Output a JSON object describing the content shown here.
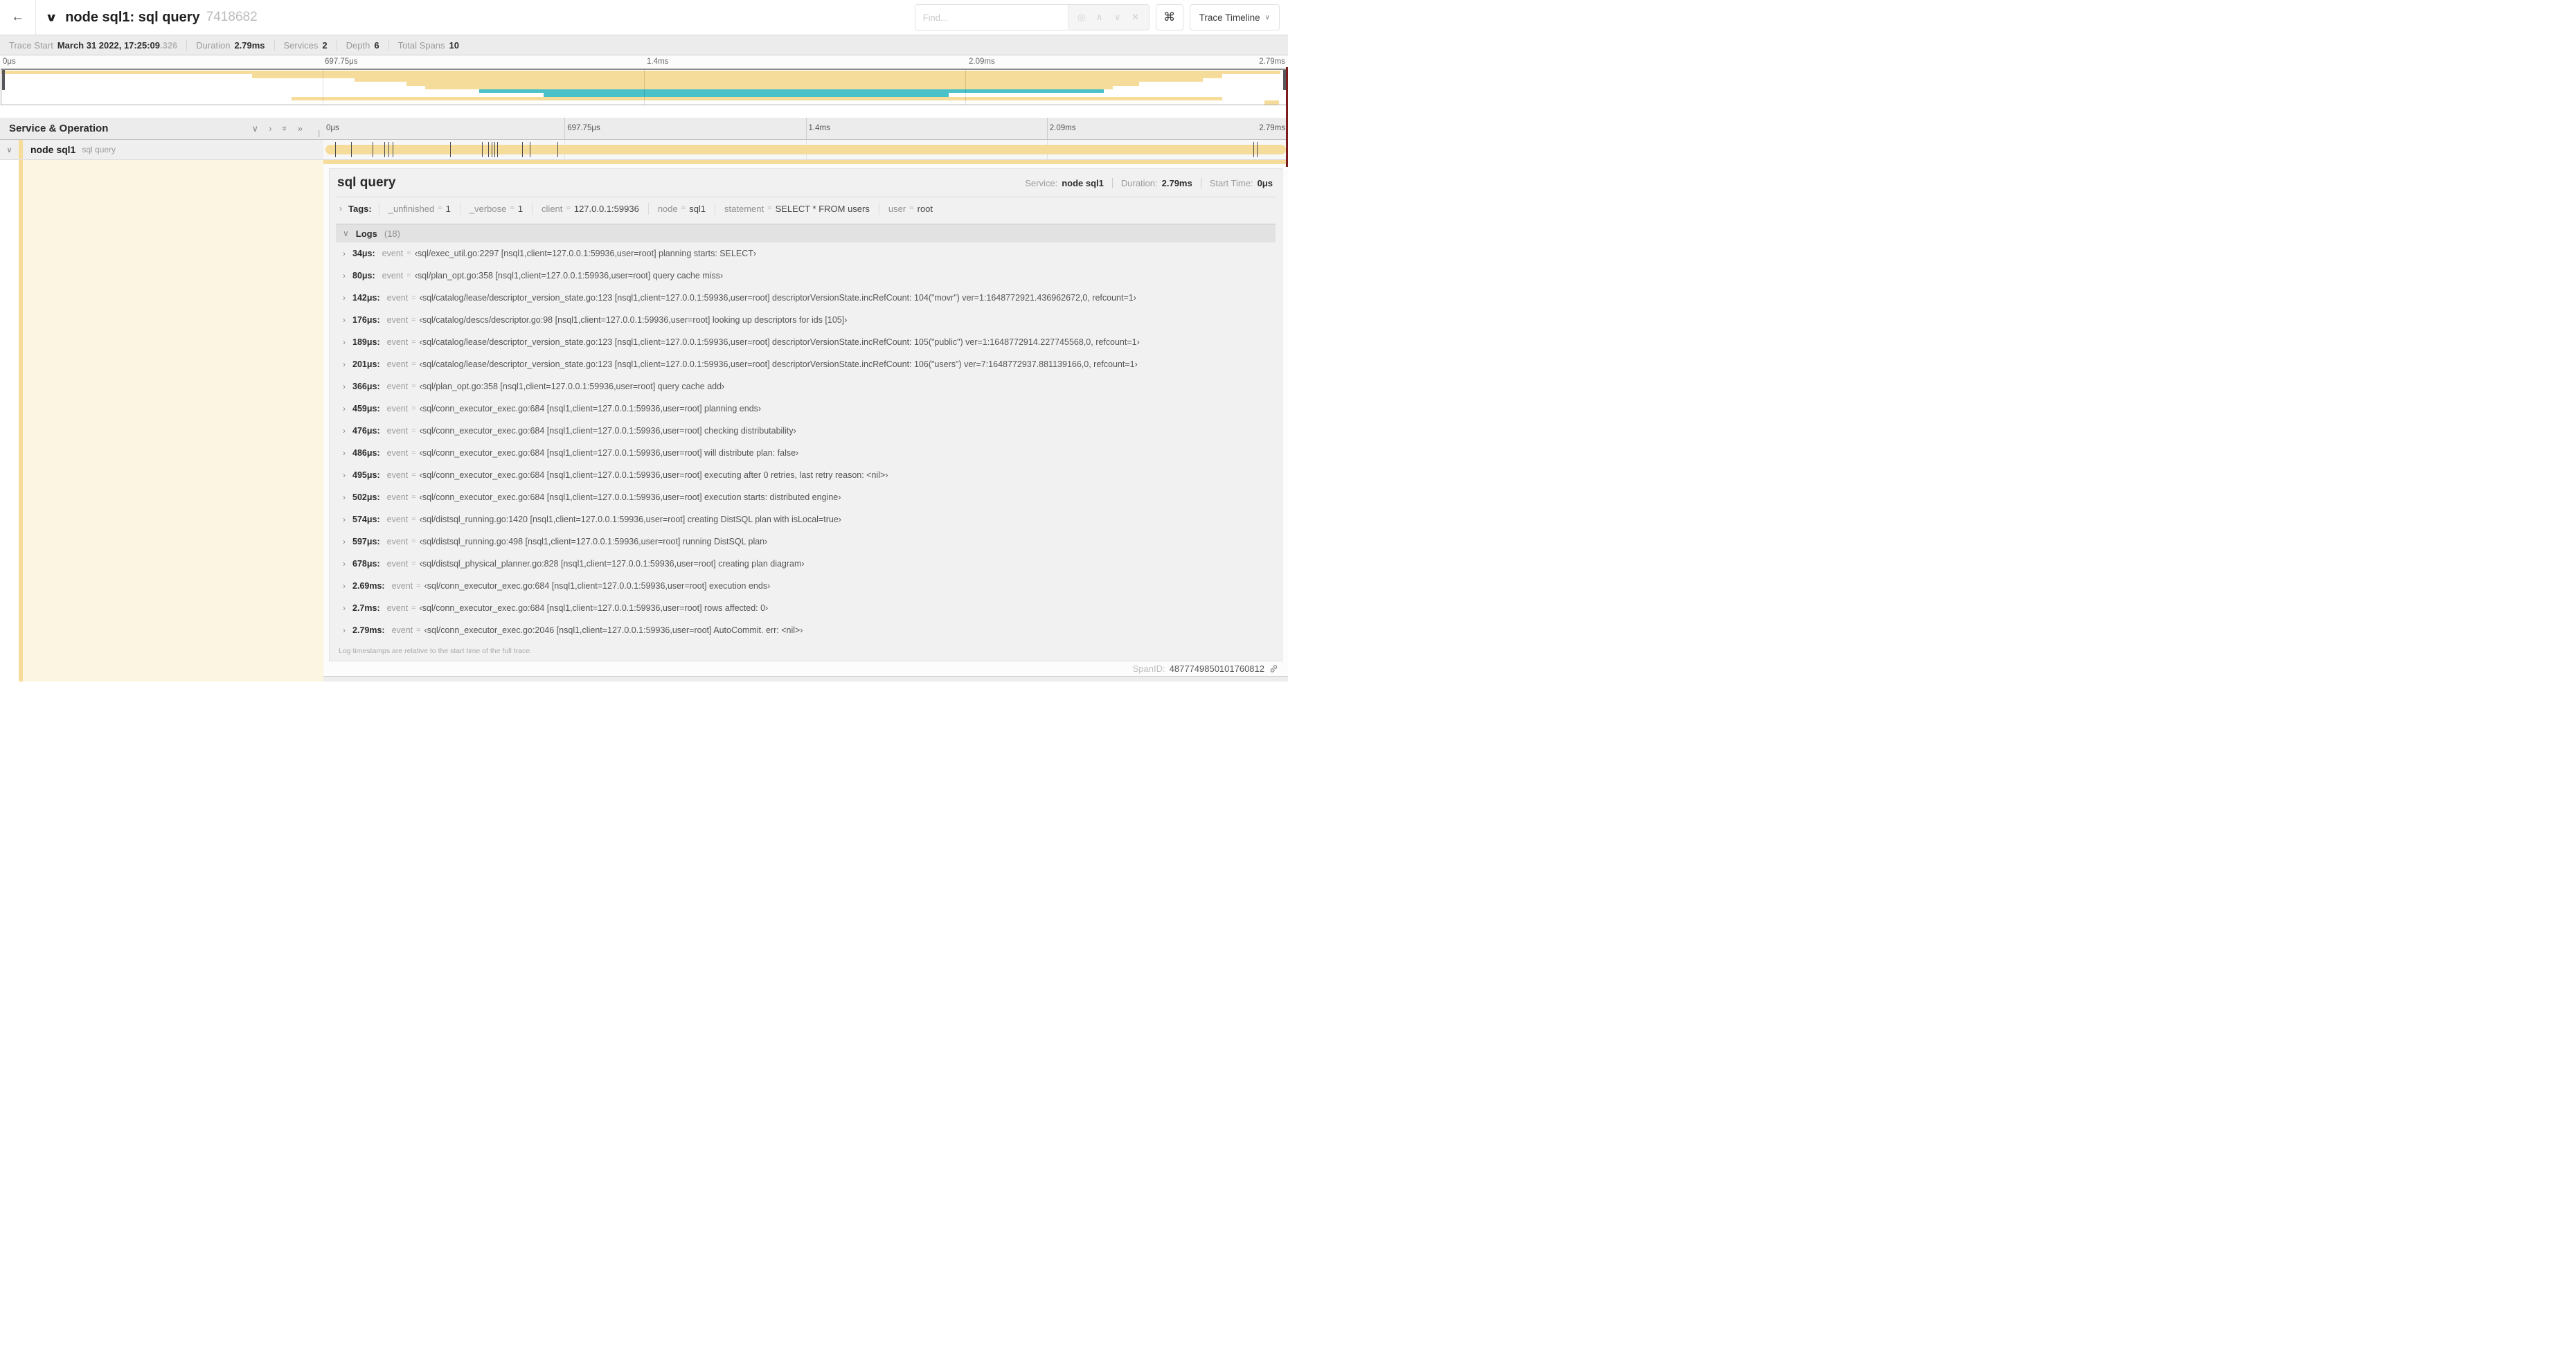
{
  "header": {
    "title": "node sql1: sql query",
    "trace_id": "7418682",
    "find_placeholder": "Find...",
    "view_selector": "Trace Timeline"
  },
  "icons": {
    "back": "←",
    "chevron_down": "∨",
    "chevron_right": "›",
    "double_chevron": "»",
    "locate": "◎",
    "prev": "∧",
    "next": "∨",
    "clear": "✕",
    "command": "⌘",
    "resize_grip": "∥"
  },
  "colors": {
    "span_bar": "#F5DC9B",
    "teal_bar": "#49C1C8",
    "detail_sidebar_bg": "#FCF5E2",
    "accent_edge": "#7B1D1D"
  },
  "trace_meta": {
    "items": [
      {
        "label": "Trace Start",
        "value": "March 31 2022, 17:25:09",
        "suffix": ".326"
      },
      {
        "label": "Duration",
        "value": "2.79ms"
      },
      {
        "label": "Services",
        "value": "2"
      },
      {
        "label": "Depth",
        "value": "6"
      },
      {
        "label": "Total Spans",
        "value": "10"
      }
    ]
  },
  "timeline": {
    "column_header": "Service & Operation",
    "ticks": [
      "0μs",
      "697.75μs",
      "1.4ms",
      "2.09ms",
      "2.79ms"
    ],
    "tick_positions": [
      0,
      25,
      50,
      75,
      100
    ]
  },
  "minimap": {
    "bars": [
      {
        "start": 0,
        "end": 99.5,
        "color": "#F5DC9B"
      },
      {
        "start": 19.5,
        "end": 95,
        "color": "#F5DC9B"
      },
      {
        "start": 27.5,
        "end": 93.5,
        "color": "#F5DC9B"
      },
      {
        "start": 31.5,
        "end": 88.5,
        "color": "#F5DC9B"
      },
      {
        "start": 33,
        "end": 86.5,
        "color": "#F5DC9B"
      },
      {
        "start": 37.2,
        "end": 85.8,
        "color": "#49C1C8"
      },
      {
        "start": 42.2,
        "end": 73.7,
        "color": "#49C1C8"
      },
      {
        "start": 22.6,
        "end": 95,
        "color": "#F5DC9B"
      },
      {
        "start": 98.3,
        "end": 99.4,
        "color": "#F5DC9B"
      }
    ]
  },
  "span_row": {
    "service": "node sql1",
    "operation": "sql query",
    "log_marker_positions": [
      1.22,
      2.87,
      5.09,
      6.31,
      6.77,
      7.2,
      13.12,
      16.45,
      17.06,
      17.42,
      17.74,
      18.0,
      20.57,
      21.4,
      24.3,
      96.42,
      96.77
    ]
  },
  "detail": {
    "title": "sql query",
    "info": [
      {
        "label": "Service:",
        "value": "node sql1"
      },
      {
        "label": "Duration:",
        "value": "2.79ms"
      },
      {
        "label": "Start Time:",
        "value": "0μs"
      }
    ],
    "tags": {
      "label": "Tags:",
      "eq": "=",
      "items": [
        {
          "key": "_unfinished",
          "value": "1"
        },
        {
          "key": "_verbose",
          "value": "1"
        },
        {
          "key": "client",
          "value": "127.0.0.1:59936"
        },
        {
          "key": "node",
          "value": "sql1"
        },
        {
          "key": "statement",
          "value": "SELECT * FROM users"
        },
        {
          "key": "user",
          "value": "root"
        }
      ]
    },
    "logs": {
      "label": "Logs",
      "count": "(18)",
      "field_label": "event",
      "eq": "=",
      "entries": [
        {
          "time": "34μs:",
          "value": "‹sql/exec_util.go:2297 [nsql1,client=127.0.0.1:59936,user=root] planning starts: SELECT›"
        },
        {
          "time": "80μs:",
          "value": "‹sql/plan_opt.go:358 [nsql1,client=127.0.0.1:59936,user=root] query cache miss›"
        },
        {
          "time": "142μs:",
          "value": "‹sql/catalog/lease/descriptor_version_state.go:123 [nsql1,client=127.0.0.1:59936,user=root] descriptorVersionState.incRefCount: 104(\"movr\") ver=1:1648772921.436962672,0, refcount=1›"
        },
        {
          "time": "176μs:",
          "value": "‹sql/catalog/descs/descriptor.go:98 [nsql1,client=127.0.0.1:59936,user=root] looking up descriptors for ids [105]›"
        },
        {
          "time": "189μs:",
          "value": "‹sql/catalog/lease/descriptor_version_state.go:123 [nsql1,client=127.0.0.1:59936,user=root] descriptorVersionState.incRefCount: 105(\"public\") ver=1:1648772914.227745568,0, refcount=1›"
        },
        {
          "time": "201μs:",
          "value": "‹sql/catalog/lease/descriptor_version_state.go:123 [nsql1,client=127.0.0.1:59936,user=root] descriptorVersionState.incRefCount: 106(\"users\") ver=7:1648772937.881139166,0, refcount=1›"
        },
        {
          "time": "366μs:",
          "value": "‹sql/plan_opt.go:358 [nsql1,client=127.0.0.1:59936,user=root] query cache add›"
        },
        {
          "time": "459μs:",
          "value": "‹sql/conn_executor_exec.go:684 [nsql1,client=127.0.0.1:59936,user=root] planning ends›"
        },
        {
          "time": "476μs:",
          "value": "‹sql/conn_executor_exec.go:684 [nsql1,client=127.0.0.1:59936,user=root] checking distributability›"
        },
        {
          "time": "486μs:",
          "value": "‹sql/conn_executor_exec.go:684 [nsql1,client=127.0.0.1:59936,user=root] will distribute plan: false›"
        },
        {
          "time": "495μs:",
          "value": "‹sql/conn_executor_exec.go:684 [nsql1,client=127.0.0.1:59936,user=root] executing after 0 retries, last retry reason: <nil>›"
        },
        {
          "time": "502μs:",
          "value": "‹sql/conn_executor_exec.go:684 [nsql1,client=127.0.0.1:59936,user=root] execution starts: distributed engine›"
        },
        {
          "time": "574μs:",
          "value": "‹sql/distsql_running.go:1420 [nsql1,client=127.0.0.1:59936,user=root] creating DistSQL plan with isLocal=true›"
        },
        {
          "time": "597μs:",
          "value": "‹sql/distsql_running.go:498 [nsql1,client=127.0.0.1:59936,user=root] running DistSQL plan›"
        },
        {
          "time": "678μs:",
          "value": "‹sql/distsql_physical_planner.go:828 [nsql1,client=127.0.0.1:59936,user=root] creating plan diagram›"
        },
        {
          "time": "2.69ms:",
          "value": "‹sql/conn_executor_exec.go:684 [nsql1,client=127.0.0.1:59936,user=root] execution ends›"
        },
        {
          "time": "2.7ms:",
          "value": "‹sql/conn_executor_exec.go:684 [nsql1,client=127.0.0.1:59936,user=root] rows affected: 0›"
        },
        {
          "time": "2.79ms:",
          "value": "‹sql/conn_executor_exec.go:2046 [nsql1,client=127.0.0.1:59936,user=root] AutoCommit. err: <nil>›"
        }
      ],
      "footer": "Log timestamps are relative to the start time of the full trace."
    },
    "span_id_label": "SpanID:",
    "span_id": "4877749850101760812"
  }
}
